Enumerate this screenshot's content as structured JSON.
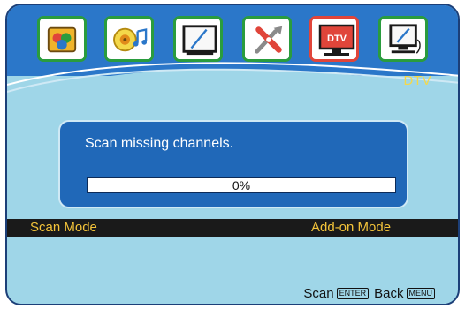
{
  "menu": {
    "icons": [
      {
        "name": "picture",
        "color": "#2a9c3e"
      },
      {
        "name": "audio",
        "color": "#2a9c3e"
      },
      {
        "name": "tv",
        "color": "#2a9c3e"
      },
      {
        "name": "setup-tools",
        "color": "#2a9c3e"
      },
      {
        "name": "dtv",
        "color": "#e0453a",
        "text": "DTV"
      },
      {
        "name": "pc",
        "color": "#2a9c3e"
      }
    ],
    "section_title": "DTV"
  },
  "scan_panel": {
    "message": "Scan missing channels.",
    "progress_percent": 0,
    "progress_text": "0%"
  },
  "mode_row": {
    "label": "Scan Mode",
    "value": "Add-on Mode"
  },
  "footer": {
    "scan_label": "Scan",
    "scan_key": "ENTER",
    "back_label": "Back",
    "back_key": "MENU"
  },
  "colors": {
    "osd_background": "#9fd6e8",
    "band_blue": "#2b77c9",
    "panel_blue": "#2068b8",
    "highlight_yellow": "#f4c43a",
    "selected_border": "#e0453a",
    "icon_border": "#2a9c3e"
  }
}
